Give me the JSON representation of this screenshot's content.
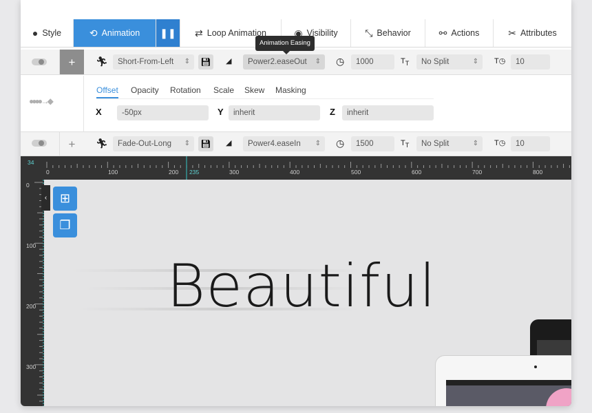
{
  "tabs": [
    {
      "label": "Style",
      "icon": "drop-icon"
    },
    {
      "label": "Animation",
      "icon": "history-icon"
    },
    {
      "label": "",
      "icon": "pause-icon"
    },
    {
      "label": "Loop Animation",
      "icon": "loop-icon"
    },
    {
      "label": "Visibility",
      "icon": "eye-icon"
    },
    {
      "label": "Behavior",
      "icon": "behavior-icon"
    },
    {
      "label": "Actions",
      "icon": "link-icon"
    },
    {
      "label": "Attributes",
      "icon": "tools-icon"
    }
  ],
  "tooltip": "Animation Easing",
  "row_in": {
    "preset": "Short-From-Left",
    "easing": "Power2.easeOut",
    "duration": "1000",
    "split": "No Split",
    "split_delay": "10",
    "plus": "+"
  },
  "subtabs": [
    "Offset",
    "Opacity",
    "Rotation",
    "Scale",
    "Skew",
    "Masking"
  ],
  "offset": {
    "x_label": "X",
    "x_value": "-50px",
    "y_label": "Y",
    "y_value": "inherit",
    "z_label": "Z",
    "z_value": "inherit"
  },
  "row_out": {
    "preset": "Fade-Out-Long",
    "easing": "Power4.easeIn",
    "duration": "1500",
    "split": "No Split",
    "split_delay": "10",
    "plus": "+"
  },
  "ruler": {
    "marker": "34",
    "cursor": "235",
    "ticks": [
      "0",
      "100",
      "200",
      "300",
      "400",
      "500",
      "600",
      "700",
      "800"
    ],
    "vticks": [
      "0",
      "100",
      "200",
      "300"
    ]
  },
  "canvas": {
    "headline": "Beautiful",
    "collapse_icon": "‹"
  },
  "colors": {
    "accent": "#3a8fdc",
    "ruler_bg": "#333333"
  }
}
